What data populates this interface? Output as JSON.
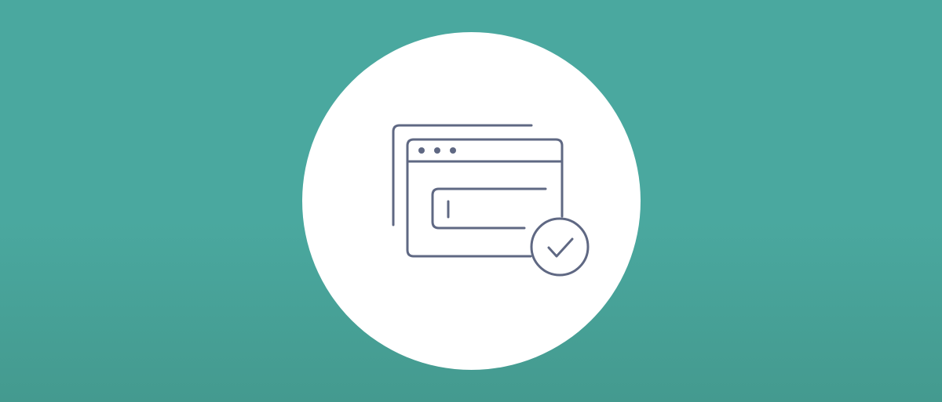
{
  "colors": {
    "background_top": "#4AA89F",
    "background_bottom": "#449A8F",
    "badge": "#FFFFFF",
    "line_art": "#5F6883"
  },
  "illustration": {
    "icon": "browser-window-with-input-field-and-check-icon",
    "window_control_dots": 3
  }
}
